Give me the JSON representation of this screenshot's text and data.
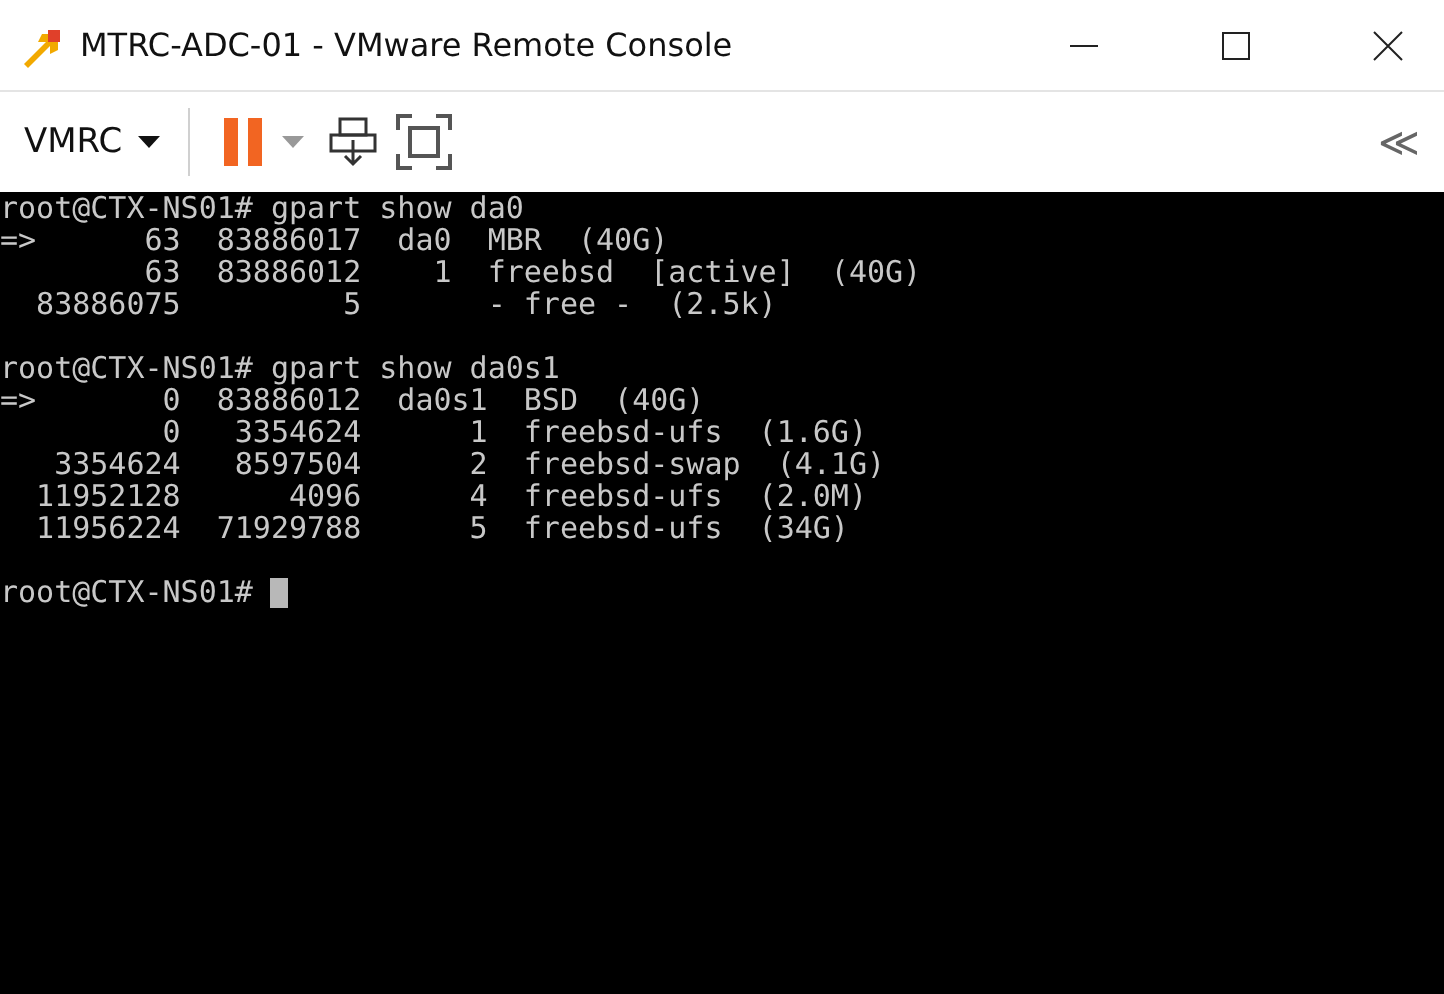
{
  "window": {
    "title": "MTRC-ADC-01 - VMware Remote Console"
  },
  "toolbar": {
    "menu": "VMRC",
    "collapse": "≪"
  },
  "terminal": {
    "blocks": [
      {
        "lines": [
          "root@CTX-NS01# gpart show da0",
          "=>      63  83886017  da0  MBR  (40G)",
          "        63  83886012    1  freebsd  [active]  (40G)",
          "  83886075         5       - free -  (2.5k)"
        ]
      },
      {
        "lines": [
          "root@CTX-NS01# gpart show da0s1",
          "=>       0  83886012  da0s1  BSD  (40G)",
          "         0   3354624      1  freebsd-ufs  (1.6G)",
          "   3354624   8597504      2  freebsd-swap  (4.1G)",
          "  11952128      4096      4  freebsd-ufs  (2.0M)",
          "  11956224  71929788      5  freebsd-ufs  (34G)"
        ]
      }
    ],
    "prompt": "root@CTX-NS01# "
  }
}
